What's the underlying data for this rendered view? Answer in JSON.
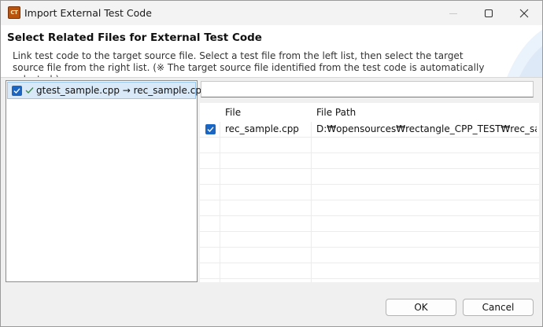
{
  "window": {
    "icon_text": "CT",
    "title": "Import External Test Code"
  },
  "header": {
    "title": "Select Related Files for External Test Code",
    "description": "Link test code to the target source file. Select a test file from the left list, then select the target source file from the right list. (※ The target source file identified from the test code is automatically selected.)"
  },
  "left_list": {
    "items": [
      {
        "label": "gtest_sample.cpp → rec_sample.cpp",
        "checked": true
      }
    ]
  },
  "filter": {
    "value": "",
    "placeholder": ""
  },
  "table": {
    "columns": [
      "",
      "File",
      "File Path"
    ],
    "rows": [
      {
        "checked": true,
        "file": "rec_sample.cpp",
        "path": "D:₩opensources₩rectangle_CPP_TEST₩rec_sample.cpp"
      }
    ]
  },
  "buttons": {
    "ok": "OK",
    "cancel": "Cancel"
  },
  "colors": {
    "accent": "#1a66c2",
    "selection": "#d9e9f8"
  }
}
